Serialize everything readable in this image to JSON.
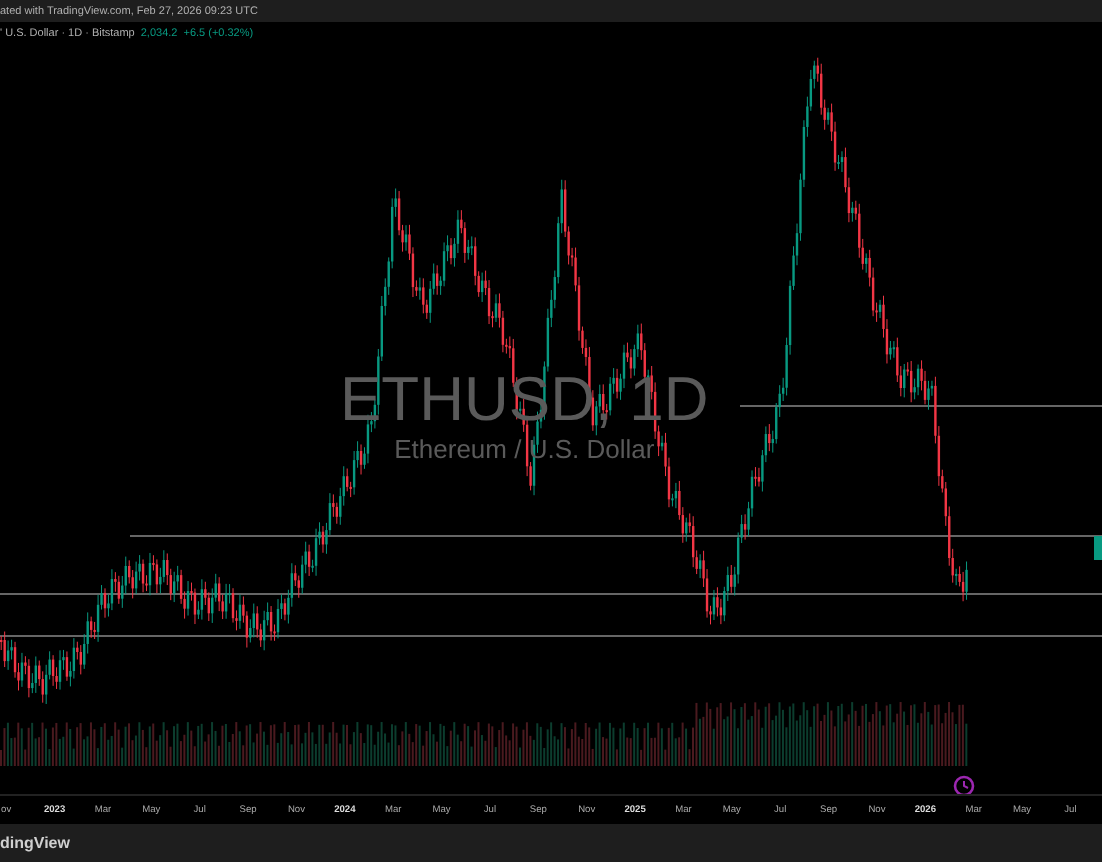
{
  "header": {
    "text": "ated with TradingView.com, Feb 27, 2026 09:23 UTC"
  },
  "legend": {
    "symbol": "' U.S. Dollar · 1D · Bitstamp",
    "price": "2,034.2",
    "change": "+6.5 (+0.32%)"
  },
  "watermark": {
    "symbol": "ETHUSD, 1D",
    "name": "Ethereum / U.S. Dollar"
  },
  "time_axis": [
    {
      "label": "ov",
      "kind": "month"
    },
    {
      "label": "2023",
      "kind": "year"
    },
    {
      "label": "Mar",
      "kind": "month"
    },
    {
      "label": "May",
      "kind": "month"
    },
    {
      "label": "Jul",
      "kind": "month"
    },
    {
      "label": "Sep",
      "kind": "month"
    },
    {
      "label": "Nov",
      "kind": "month"
    },
    {
      "label": "2024",
      "kind": "year"
    },
    {
      "label": "Mar",
      "kind": "month"
    },
    {
      "label": "May",
      "kind": "month"
    },
    {
      "label": "Jul",
      "kind": "month"
    },
    {
      "label": "Sep",
      "kind": "month"
    },
    {
      "label": "Nov",
      "kind": "month"
    },
    {
      "label": "2025",
      "kind": "year"
    },
    {
      "label": "Mar",
      "kind": "month"
    },
    {
      "label": "May",
      "kind": "month"
    },
    {
      "label": "Jul",
      "kind": "month"
    },
    {
      "label": "Sep",
      "kind": "month"
    },
    {
      "label": "Nov",
      "kind": "month"
    },
    {
      "label": "2026",
      "kind": "year"
    },
    {
      "label": "Mar",
      "kind": "month"
    },
    {
      "label": "May",
      "kind": "month"
    },
    {
      "label": "Jul",
      "kind": "month"
    }
  ],
  "footer": {
    "brand": "dingView"
  }
}
